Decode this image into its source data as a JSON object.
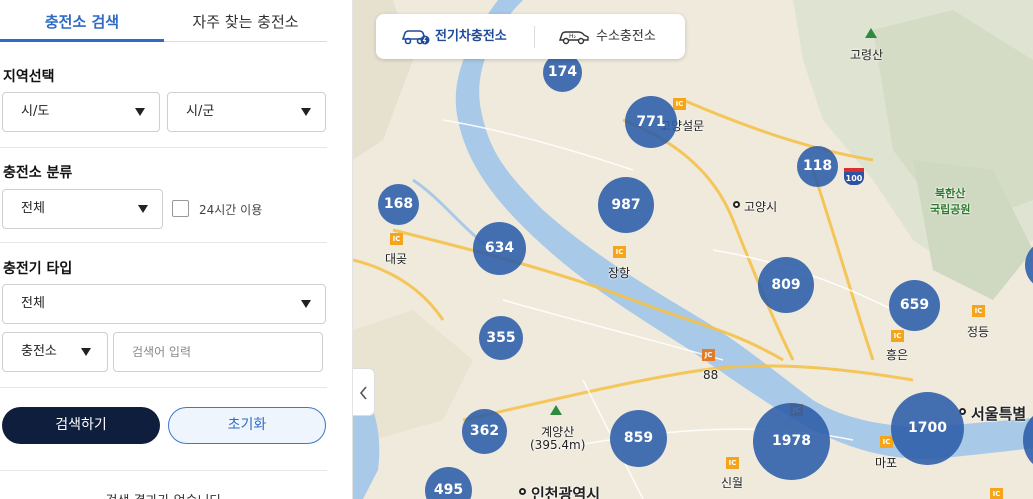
{
  "tabs": {
    "search": "충전소 검색",
    "favorites": "자주 찾는 충전소"
  },
  "region": {
    "title": "지역선택",
    "sido": "시/도",
    "sigun": "시/군"
  },
  "category": {
    "title": "충전소 분류",
    "value": "전체",
    "always_open_label": "24시간 이용"
  },
  "charger_type": {
    "title": "충전기 타입",
    "value": "전체"
  },
  "keyword": {
    "scope": "충전소",
    "placeholder": "검색어 입력"
  },
  "buttons": {
    "search": "검색하기",
    "reset": "초기화"
  },
  "results": {
    "empty": "검색 결과가 없습니다"
  },
  "map": {
    "toggle": {
      "ev": "전기차충전소",
      "hydrogen": "수소충전소"
    },
    "clusters": [
      {
        "count": "174"
      },
      {
        "count": "771"
      },
      {
        "count": "118"
      },
      {
        "count": "168"
      },
      {
        "count": "987"
      },
      {
        "count": "634"
      },
      {
        "count": "809"
      },
      {
        "count": "659"
      },
      {
        "count": "355"
      },
      {
        "count": "362"
      },
      {
        "count": "859"
      },
      {
        "count": "1978"
      },
      {
        "count": "1700"
      },
      {
        "count": "495"
      }
    ],
    "labels": {
      "goryeongsan": "고령산",
      "goyang_seolmun": "고양설문",
      "goyangsi": "고양시",
      "bukhansan": "북한산\n국립공원",
      "daegot": "대곶",
      "janghang": "장항",
      "jeongdeung": "정등",
      "heungeun": "흥은",
      "road88": "88",
      "road100": "100",
      "seoul": "서울특별",
      "gyeyangsan": "계양산\n(395.4m)",
      "mapo": "마포",
      "sinwol": "신월",
      "incheon": "인천광역시",
      "ic": "IC",
      "jc": "JC"
    }
  },
  "colors": {
    "accent": "#2d6bc4",
    "search_button": "#0f1e3d",
    "cluster": "#2b5ca8",
    "river": "#a8c9e8"
  }
}
